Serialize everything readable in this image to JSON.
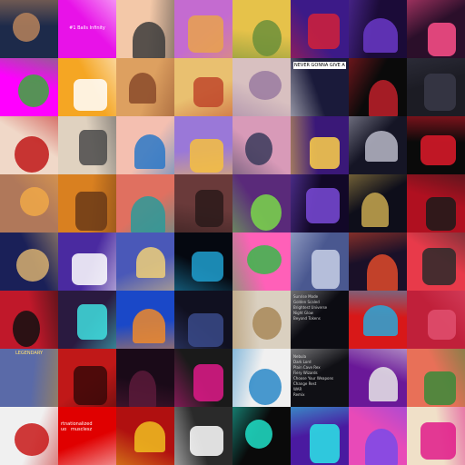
{
  "grid": {
    "rows": 8,
    "columns": 8,
    "tiles": [
      {
        "subject": "cartoon brown cat on dark night sky",
        "colors": [
          "#1d2a4a",
          "#b7835a"
        ]
      },
      {
        "subject": "magenta square with caption",
        "colors": [
          "#e812e8",
          "#ffffff"
        ],
        "text": "#1 Balls Infinity"
      },
      {
        "subject": "cartoon badger on peach background",
        "colors": [
          "#f3c8a8",
          "#3b3b3b"
        ]
      },
      {
        "subject": "purple-haired punk character on orange sky",
        "colors": [
          "#c46bd0",
          "#e9a24c"
        ]
      },
      {
        "subject": "cartoon figure on green-yellow gradient",
        "colors": [
          "#e6c24a",
          "#6b8f3a"
        ]
      },
      {
        "subject": "red and blue abstract sigil",
        "colors": [
          "#3c1a88",
          "#d2213a"
        ]
      },
      {
        "subject": "psychedelic swirl sphere",
        "colors": [
          "#1b0b38",
          "#6a38c8"
        ]
      },
      {
        "subject": "rainbow stripes with dark oval",
        "colors": [
          "#2b0f2a",
          "#ff4f8a"
        ]
      },
      {
        "subject": "green frog with top hat on magenta",
        "colors": [
          "#ff00ff",
          "#3aaa3a"
        ]
      },
      {
        "subject": "white and purple robot bear",
        "colors": [
          "#f5a623",
          "#ffffff"
        ]
      },
      {
        "subject": "orange ornate shell",
        "colors": [
          "#dda060",
          "#8a4a2a"
        ]
      },
      {
        "subject": "red panda with strawberry hat",
        "colors": [
          "#e9c070",
          "#c0462a"
        ]
      },
      {
        "subject": "pastel leaves",
        "colors": [
          "#d8c0c0",
          "#9a7aa0"
        ]
      },
      {
        "subject": "photo card with headline",
        "colors": [
          "#1a1a3a",
          "#ffffff"
        ],
        "text": "NEVER GONNA GIVE A FUCK!"
      },
      {
        "subject": "red skull on black",
        "colors": [
          "#0a0a0a",
          "#c0202a"
        ]
      },
      {
        "subject": "dark hooded figures",
        "colors": [
          "#1c1c24",
          "#383848"
        ]
      },
      {
        "subject": "woman with sunglasses and red hair",
        "colors": [
          "#f0d8c8",
          "#c01818"
        ]
      },
      {
        "subject": "sketch of a horse-like animal",
        "colors": [
          "#e0d2c0",
          "#4a4a4a"
        ]
      },
      {
        "subject": "character with blue beanie",
        "colors": [
          "#f4bfb0",
          "#2a78c8"
        ]
      },
      {
        "subject": "yellow cartoon cat with blue hair",
        "colors": [
          "#9a78d8",
          "#f6c040"
        ]
      },
      {
        "subject": "vaporwave checkerboard with cat",
        "colors": [
          "#d89ab8",
          "#3a3a5a"
        ]
      },
      {
        "subject": "cartoon rocket in space",
        "colors": [
          "#3a1878",
          "#ffd14a"
        ]
      },
      {
        "subject": "silver dragon head",
        "colors": [
          "#151525",
          "#b8b8c8"
        ]
      },
      {
        "subject": "red pixel-art cat",
        "colors": [
          "#0a0a0a",
          "#e01a2a"
        ]
      },
      {
        "subject": "woman with glowing hair",
        "colors": [
          "#b0785a",
          "#f0a848"
        ]
      },
      {
        "subject": "orange character with mask",
        "colors": [
          "#d98020",
          "#6a3a18"
        ]
      },
      {
        "subject": "character with purple hair and cap",
        "colors": [
          "#e07060",
          "#2a9a9a"
        ]
      },
      {
        "subject": "dusky canyon",
        "colors": [
          "#6a3a3a",
          "#2a1a1a"
        ]
      },
      {
        "subject": "green skull with crossed swords",
        "colors": [
          "#5a2a7a",
          "#7ad84a"
        ]
      },
      {
        "subject": "purple neon arch tunnel",
        "colors": [
          "#120828",
          "#7a4ad8"
        ]
      },
      {
        "subject": "keyhole on dark circle",
        "colors": [
          "#0e0e1a",
          "#c8a850"
        ]
      },
      {
        "subject": "black masked figure on red",
        "colors": [
          "#b01020",
          "#1a1a1a"
        ]
      },
      {
        "subject": "small computer robot on wood",
        "colors": [
          "#1a2058",
          "#d8b070"
        ]
      },
      {
        "subject": "white pixel cat on purple",
        "colors": [
          "#4a2aa0",
          "#ffffff"
        ]
      },
      {
        "subject": "witch on broom over moon",
        "colors": [
          "#4a58b8",
          "#f0d078"
        ]
      },
      {
        "subject": "cyan glitch butterfly",
        "colors": [
          "#050810",
          "#20a0d0"
        ]
      },
      {
        "subject": "green alien with sunglasses",
        "colors": [
          "#ff60b8",
          "#3ab84a"
        ]
      },
      {
        "subject": "ethereum diamond emblem",
        "colors": [
          "#4a5890",
          "#c8d0e8"
        ]
      },
      {
        "subject": "red sunset with silhouettes",
        "colors": [
          "#1a1028",
          "#e04a2a"
        ]
      },
      {
        "subject": "bearded character on red",
        "colors": [
          "#e83a4a",
          "#2a2a2a"
        ]
      },
      {
        "subject": "black shark fin on red",
        "colors": [
          "#c0182a",
          "#101010"
        ]
      },
      {
        "subject": "robot with cyan eyes",
        "colors": [
          "#2a1a40",
          "#40e0e0"
        ]
      },
      {
        "subject": "orange cartoon astronaut",
        "colors": [
          "#1a48c8",
          "#f08a2a"
        ]
      },
      {
        "subject": "dark blurred figure",
        "colors": [
          "#101020",
          "#3a4a8a"
        ]
      },
      {
        "subject": "cardboard box",
        "colors": [
          "#dad0c0",
          "#a88858"
        ]
      },
      {
        "subject": "dark card with text list",
        "colors": [
          "#0c0c12",
          "#c8c8c8"
        ],
        "text": "Sunrise Mode\nGolden Scaled\nBrightest Universe\nNight Glow\nBeyond Tokens"
      },
      {
        "subject": "zigzag pattern with blue face",
        "colors": [
          "#d81818",
          "#2aa8d8"
        ]
      },
      {
        "subject": "red geometric animal",
        "colors": [
          "#c0203a",
          "#e05070"
        ]
      },
      {
        "subject": "game card with knight",
        "colors": [
          "#5a6aa8",
          "#c09030"
        ],
        "text": "LEGENDARY"
      },
      {
        "subject": "red demon mask",
        "colors": [
          "#c01818",
          "#3a0808"
        ]
      },
      {
        "subject": "dark purple shards",
        "colors": [
          "#1a0a18",
          "#5a1a3a"
        ]
      },
      {
        "subject": "person in neon circle",
        "colors": [
          "#1a1a1a",
          "#e01a8a"
        ]
      },
      {
        "subject": "aquarium tank",
        "colors": [
          "#f0f0f0",
          "#2a88c8"
        ]
      },
      {
        "subject": "dark card with text list",
        "colors": [
          "#101015",
          "#d0d0d0"
        ],
        "text": "Nebula\nDark Lord\nPlain Cave Rex\nFiery Wizards\nChoose Your Weapons\nChange Rest\nWAR\nRemix"
      },
      {
        "subject": "computer mascot with TV head",
        "colors": [
          "#6a1898",
          "#e8e8e8"
        ]
      },
      {
        "subject": "character with green hat",
        "colors": [
          "#e87058",
          "#3a8a3a"
        ]
      },
      {
        "subject": "samurai with red sun rays",
        "colors": [
          "#f0f0f0",
          "#c81818"
        ]
      },
      {
        "subject": "red field with overlaid text",
        "colors": [
          "#e00000",
          "#ffffff"
        ],
        "text": "rtnationalized\nuo   musclesz"
      },
      {
        "subject": "gold bitcoin coins",
        "colors": [
          "#b01010",
          "#f0c020"
        ]
      },
      {
        "subject": "black ring eye",
        "colors": [
          "#2a2a2a",
          "#ffffff"
        ]
      },
      {
        "subject": "neon pixel monster",
        "colors": [
          "#0a0a0a",
          "#20e0c8"
        ]
      },
      {
        "subject": "neon skull with mushrooms",
        "colors": [
          "#4a1aa0",
          "#2ae8e8"
        ]
      },
      {
        "subject": "pink purple dreamy gradient",
        "colors": [
          "#e84ab8",
          "#7a4ae8"
        ]
      },
      {
        "subject": "pop art character with wild hair",
        "colors": [
          "#f0e0c8",
          "#e01a8a"
        ]
      }
    ]
  }
}
